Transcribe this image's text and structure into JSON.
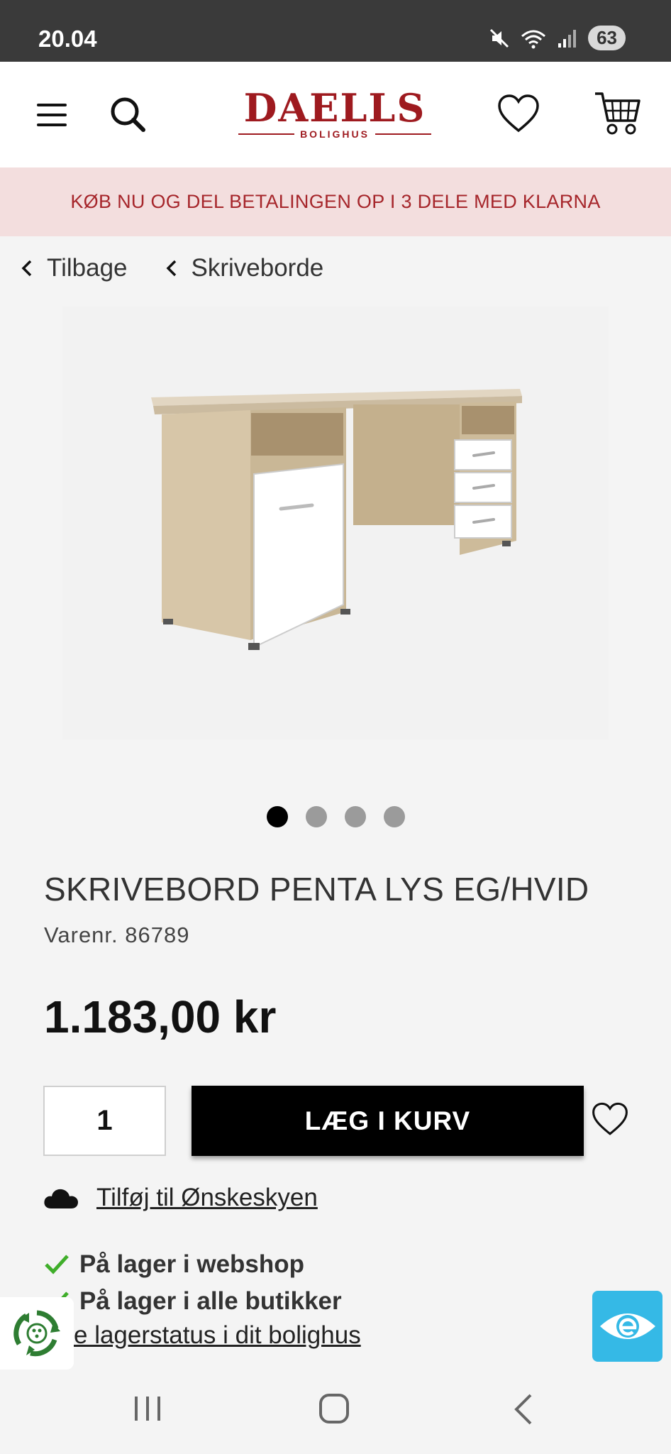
{
  "status": {
    "time": "20.04",
    "battery": "63"
  },
  "header": {
    "logo_main": "DAELLS",
    "logo_sub": "BOLIGHUS",
    "icons": [
      "menu-icon",
      "search-icon",
      "heart-icon",
      "cart-icon"
    ]
  },
  "promo": {
    "text": "KØB NU OG DEL BETALINGEN OP I 3 DELE MED KLARNA",
    "color": "#a6262b",
    "background": "#f3dede"
  },
  "breadcrumbs": {
    "back": "Tilbage",
    "category": "Skriveborde"
  },
  "gallery": {
    "image_count": 4,
    "active_index": 0
  },
  "product": {
    "title": "SKRIVEBORD PENTA LYS EG/HVID",
    "sku": "Varenr. 86789",
    "price": "1.183,00 kr",
    "quantity": "1",
    "add_to_cart": "LÆG I KURV"
  },
  "wishlist": {
    "label": "Tilføj til Ønskeskyen"
  },
  "stock": {
    "webshop": "På lager i webshop",
    "stores": "På lager i alle butikker",
    "link": "e lagerstatus i dit bolighus",
    "check_color": "#3fae2a"
  },
  "brand": {
    "accent": "#9e1a1f",
    "badge_blue": "#35b9e6"
  }
}
